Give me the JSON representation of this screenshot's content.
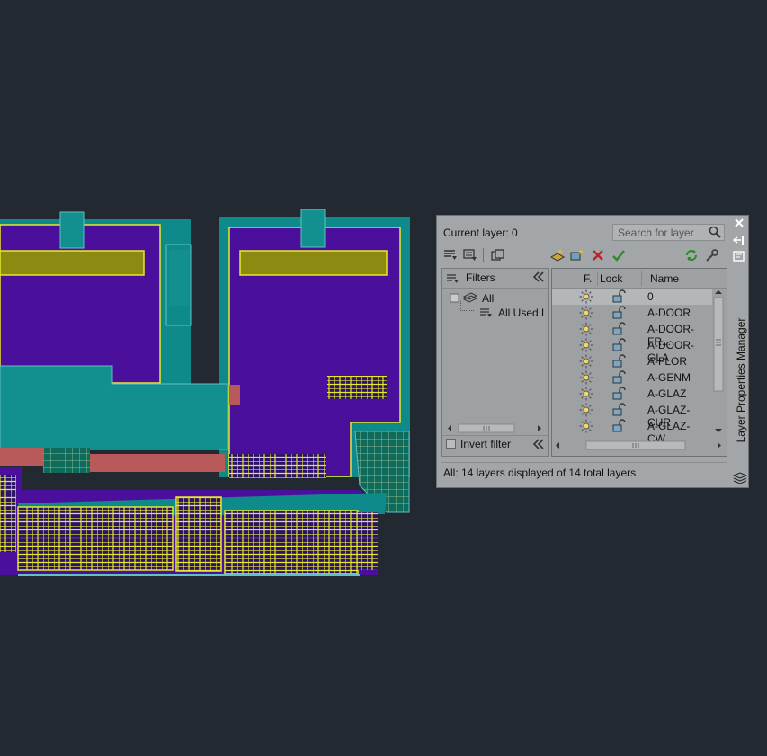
{
  "panel": {
    "current_layer": "Current layer: 0",
    "search_placeholder": "Search for layer",
    "title": "Layer Properties Manager"
  },
  "filters": {
    "header": "Filters",
    "tree": [
      "All",
      "All Used L"
    ],
    "invert_filter": "Invert filter"
  },
  "grid": {
    "columns": [
      "F.",
      "Lock",
      "Name"
    ],
    "rows": [
      {
        "name": "0"
      },
      {
        "name": "A-DOOR"
      },
      {
        "name": "A-DOOR-FR..."
      },
      {
        "name": "A-DOOR-GLA"
      },
      {
        "name": "A-FLOR"
      },
      {
        "name": "A-GENM"
      },
      {
        "name": "A-GLAZ"
      },
      {
        "name": "A-GLAZ-CUR"
      },
      {
        "name": "A-GLAZ-CW..."
      }
    ]
  },
  "status": "All: 14 layers displayed of 14 total layers",
  "icons": {
    "row_freeze": "sun-icon",
    "row_lock": "unlock-icon",
    "toolbar": [
      "new-property-filter-icon",
      "new-group-filter-icon",
      "layer-states-icon",
      "new-layer-icon",
      "new-layer-vp-frozen-icon",
      "delete-layer-icon",
      "set-current-icon",
      "refresh-icon",
      "settings-icon"
    ]
  },
  "colors": {
    "background": "#232930",
    "floor_fill": "#4a0f9b",
    "wall": "#0f8a8a",
    "teal_block": "#128f8f",
    "outline": "#e8e82a",
    "olive": "#8c8a10",
    "brick": "#b85a5a",
    "panel": "#a3a6a8"
  }
}
